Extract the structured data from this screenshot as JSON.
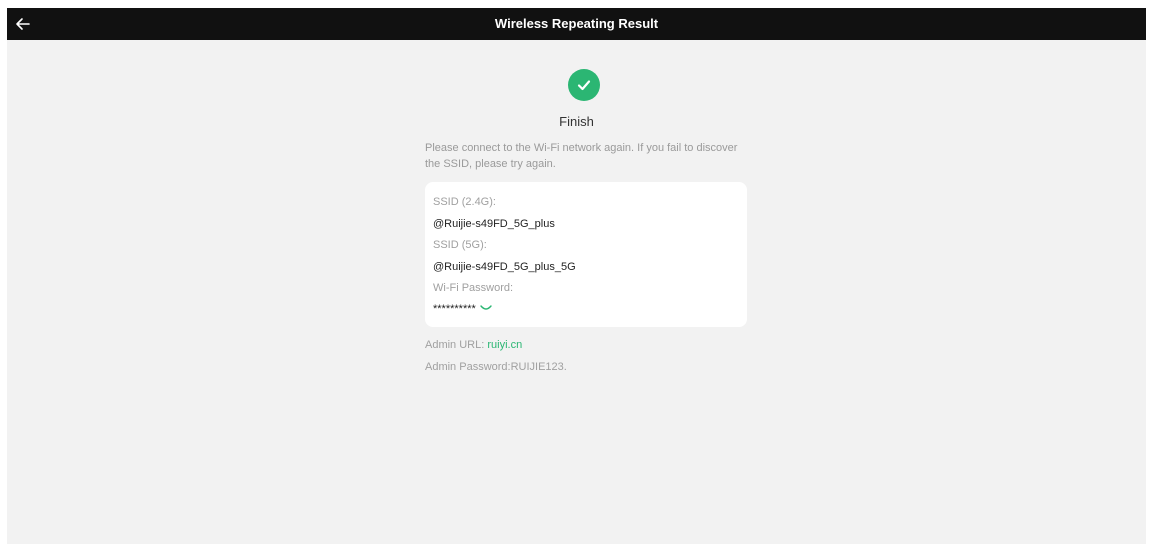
{
  "header": {
    "title": "Wireless Repeating Result"
  },
  "result": {
    "status": "Finish",
    "hint": "Please connect to the Wi-Fi network again. If you fail to discover the SSID, please try again."
  },
  "card": {
    "ssid24_label": "SSID (2.4G):",
    "ssid24_value": "@Ruijie-s49FD_5G_plus",
    "ssid5_label": "SSID (5G):",
    "ssid5_value": "@Ruijie-s49FD_5G_plus_5G",
    "password_label": "Wi-Fi Password:",
    "password_value": "**********"
  },
  "admin": {
    "url_label": "Admin URL:",
    "url_value": "ruiyi.cn",
    "password_text": "Admin Password:RUIJIE123."
  },
  "colors": {
    "accent": "#2bb673",
    "topbar": "#111111",
    "background": "#f2f2f2"
  },
  "icons": {
    "back": "arrow-left-icon",
    "success": "check-circle-icon",
    "reveal": "eye-closed-icon"
  }
}
